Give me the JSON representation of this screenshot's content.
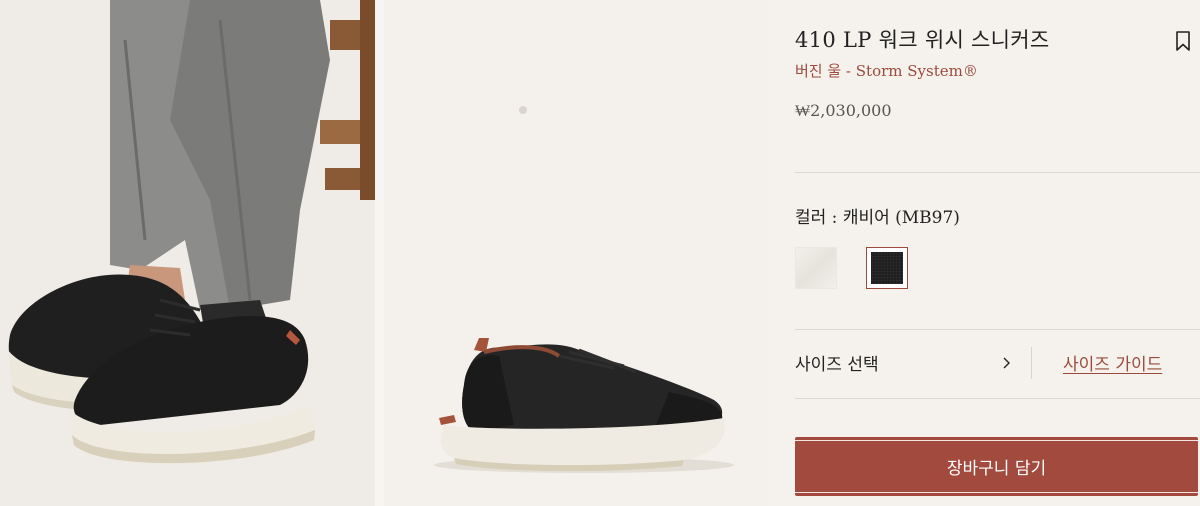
{
  "product": {
    "title": "410 LP 워크 위시 스니커즈",
    "subtitle": "버진 울 - Storm System®",
    "price": "₩2,030,000"
  },
  "color": {
    "label": "컬러 : 캐비어 (MB97)",
    "swatches": [
      {
        "name": "light",
        "hex": "#efece6"
      },
      {
        "name": "caviar",
        "hex": "#1e1e1e",
        "selected": true
      }
    ]
  },
  "size": {
    "select_label": "사이즈 선택",
    "guide_label": "사이즈 가이드"
  },
  "cart": {
    "button_label": "장바구니 담기"
  },
  "icons": {
    "bookmark": "bookmark-icon",
    "chevron": "chevron-right-icon"
  },
  "colors": {
    "accent": "#a14a3d",
    "subtitle": "#9b4a3c",
    "background": "#f5f2ed"
  }
}
